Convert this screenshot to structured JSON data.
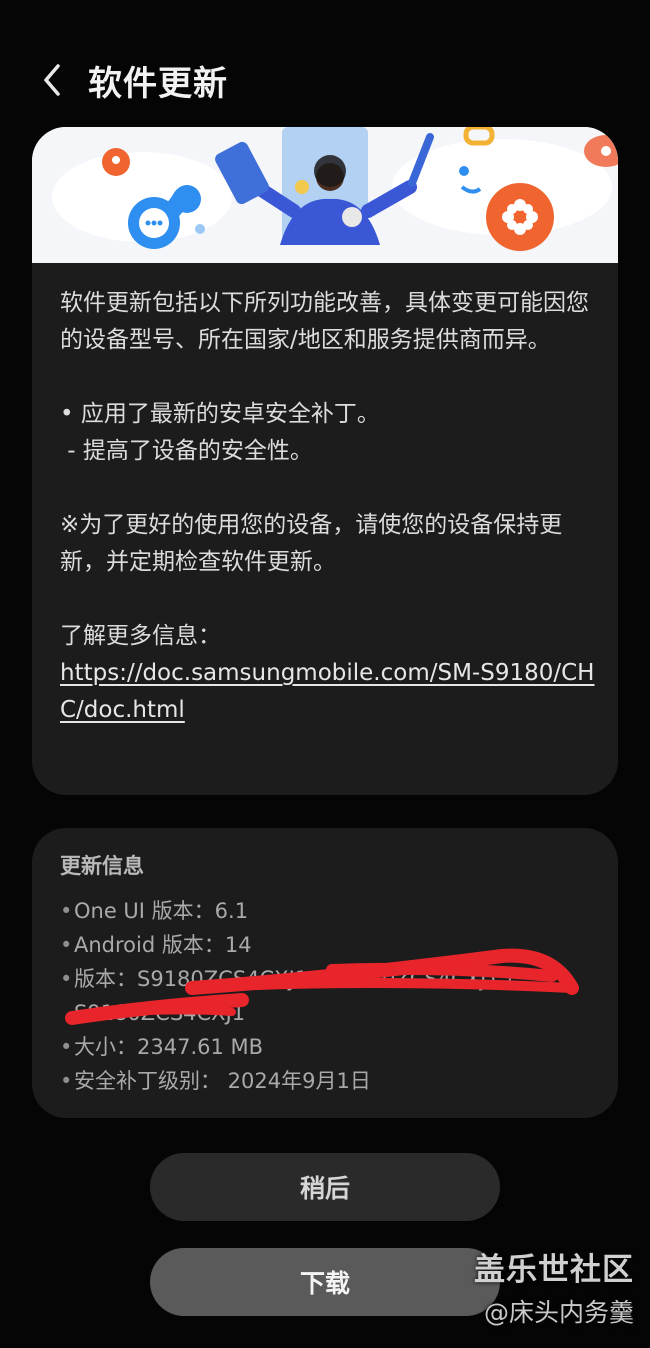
{
  "header": {
    "title": "软件更新"
  },
  "release_notes": {
    "intro": "软件更新包括以下所列功能改善，具体变更可能因您的设备型号、所在国家/地区和服务提供商而异。",
    "item_1": "• 应用了最新的安卓安全补丁。",
    "item_1_sub": " - 提高了设备的安全性。",
    "reminder": "※为了更好的使用您的设备，请使您的设备保持更新，并定期检查软件更新。",
    "more_info_label": "了解更多信息：",
    "more_info_link": "https://doc.samsungmobile.com/SM-S9180/CHC/doc.html"
  },
  "update_info": {
    "title": "更新信息",
    "items": [
      "One UI 版本：6.1",
      "Android 版本：14",
      "版本：S9180ZCS4CXJ1 / S9180ZCS4CXJ1 / S9180ZCS4CXJ1",
      "大小：2347.61 MB",
      "安全补丁级别： 2024年9月1日"
    ]
  },
  "buttons": {
    "later": "稍后",
    "download": "下载"
  },
  "watermark": {
    "title": "盖乐世社区",
    "user": "@床头内务羹"
  },
  "colors": {
    "background": "#050505",
    "card": "#1c1c1c",
    "banner_bg": "#f4f6fa",
    "accent_orange": "#f0652f",
    "accent_blue": "#2e8ff0",
    "redaction": "#e8252b"
  }
}
